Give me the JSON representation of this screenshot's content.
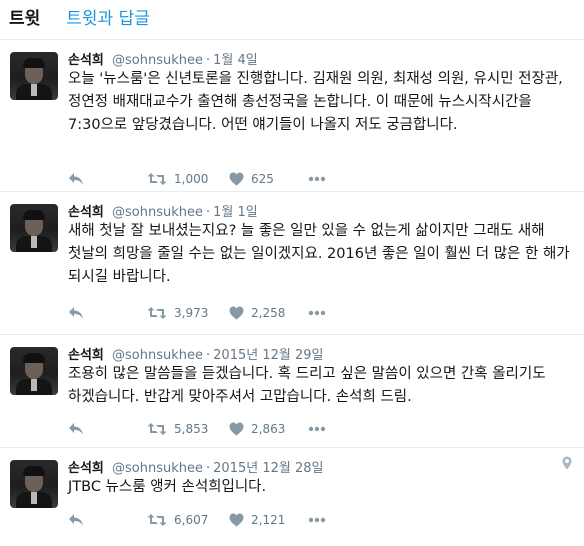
{
  "tabs": [
    {
      "label": "트윗",
      "active": true
    },
    {
      "label": "트윗과 답글",
      "active": false
    }
  ],
  "colors": {
    "link": "#1b95e0",
    "muted": "#657786",
    "icon": "#8899a6",
    "border": "#e6ecf0"
  },
  "tweets": [
    {
      "name": "손석희",
      "handle": "@sohnsukhee",
      "date": "1월 4일",
      "text": "오늘 '뉴스룸'은 신년토론을 진행합니다. 김재원 의원, 최재성 의원, 유시민 전장관, 정연정 배재대교수가 출연해 총선정국을 논합니다. 이 때문에 뉴스시작시간을 7:30으로 앞당겼습니다. 어떤 얘기들이 나올지 저도 궁금합니다.",
      "retweets": "1,000",
      "likes": "625"
    },
    {
      "name": "손석희",
      "handle": "@sohnsukhee",
      "date": "1월 1일",
      "text": "새해 첫날 잘 보내셨는지요? 늘 좋은 일만 있을 수 없는게 삶이지만 그래도 새해 첫날의 희망을 줄일 수는 없는 일이겠지요. 2016년 좋은 일이 훨씬 더 많은 한 해가 되시길 바랍니다.",
      "retweets": "3,973",
      "likes": "2,258"
    },
    {
      "name": "손석희",
      "handle": "@sohnsukhee",
      "date": "2015년 12월 29일",
      "text": "조용히 많은 말씀들을 듣겠습니다. 혹 드리고 싶은 말씀이 있으면 간혹 올리기도 하겠습니다. 반갑게 맞아주셔서 고맙습니다. 손석희 드림.",
      "retweets": "5,853",
      "likes": "2,863"
    },
    {
      "name": "손석희",
      "handle": "@sohnsukhee",
      "date": "2015년 12월 28일",
      "text": "JTBC 뉴스룸 앵커 손석희입니다.",
      "retweets": "6,607",
      "likes": "2,121",
      "geo_icon": "location-pin-icon"
    }
  ]
}
